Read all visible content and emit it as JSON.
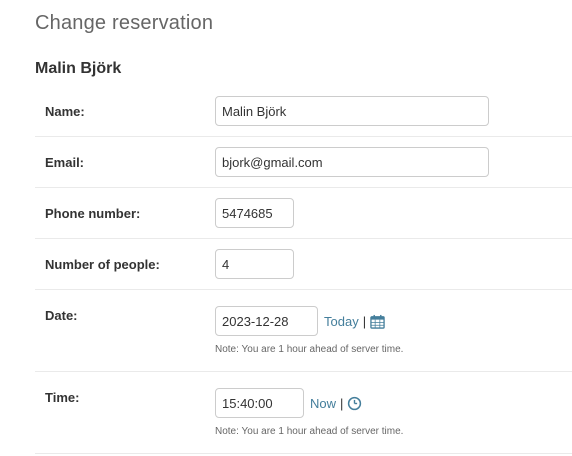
{
  "header": {
    "title": "Change reservation"
  },
  "object": {
    "title": "Malin Björk"
  },
  "fields": {
    "name": {
      "label": "Name:",
      "value": "Malin Björk"
    },
    "email": {
      "label": "Email:",
      "value": "bjork@gmail.com"
    },
    "phone": {
      "label": "Phone number:",
      "value": "5474685"
    },
    "people": {
      "label": "Number of people:",
      "value": "4"
    },
    "date": {
      "label": "Date:",
      "value": "2023-12-28",
      "shortcut_label": "Today",
      "separator": "|",
      "icon": "calendar-icon",
      "help": "Note: You are 1 hour ahead of server time."
    },
    "time": {
      "label": "Time:",
      "value": "15:40:00",
      "shortcut_label": "Now",
      "separator": "|",
      "icon": "clock-icon",
      "help": "Note: You are 1 hour ahead of server time."
    }
  },
  "colors": {
    "link": "#447e9b",
    "border": "#cccccc",
    "divider": "#eaeaea"
  }
}
